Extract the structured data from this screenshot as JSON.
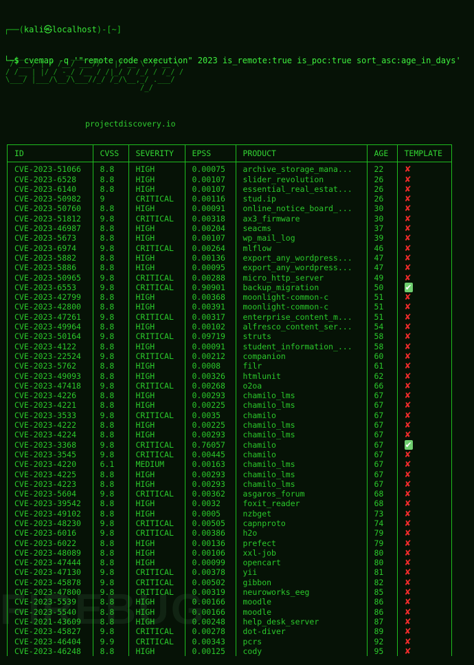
{
  "terminal": {
    "prompt": {
      "line1_prefix": "┌──(",
      "user": "kali",
      "dragon_glyph": "㉿",
      "host": "localhost",
      "line1_suffix": ")-[~]",
      "line2_prefix": "└─$ ",
      "command": "cvemap -q '\"remote code execution\" 2023 is_remote:true is_poc:true sort_asc:age_in_days'"
    },
    "banner_ascii": " ______   _    _____ ___  ____    ____ \n / ___/ | / /__/ ___//   |/ __ \\  / __ \\\n/ /__ | |/ / -_/ /__ / /|_/ / /_/ / /_/ /\n\\___/ |___/\\__/\\___//_/ /_/\\__,_/ .___/ \n                               /_/      ",
    "tagline": "projectdiscovery.io",
    "watermark": "FIREBUG"
  },
  "table": {
    "columns": [
      {
        "key": "id",
        "label": "ID"
      },
      {
        "key": "cvss",
        "label": "CVSS"
      },
      {
        "key": "severity",
        "label": "SEVERITY"
      },
      {
        "key": "epss",
        "label": "EPSS"
      },
      {
        "key": "product",
        "label": "PRODUCT"
      },
      {
        "key": "age",
        "label": "AGE"
      },
      {
        "key": "template",
        "label": "TEMPLATE"
      }
    ],
    "marks": {
      "no": "✘",
      "yes": "✔",
      "no_icon_name": "cross-mark-icon",
      "yes_icon_name": "check-mark-icon",
      "no_color": "#ee2b2b",
      "yes_bg_color": "#6fcf6f"
    },
    "rows": [
      {
        "id": "CVE-2023-51066",
        "cvss": "8.8",
        "severity": "HIGH",
        "epss": "0.00075",
        "product": "archive_storage_mana...",
        "age": "22",
        "template": "no"
      },
      {
        "id": "CVE-2023-6528",
        "cvss": "8.8",
        "severity": "HIGH",
        "epss": "0.00107",
        "product": "slider_revolution",
        "age": "26",
        "template": "no"
      },
      {
        "id": "CVE-2023-6140",
        "cvss": "8.8",
        "severity": "HIGH",
        "epss": "0.00107",
        "product": "essential_real_estat...",
        "age": "26",
        "template": "no"
      },
      {
        "id": "CVE-2023-50982",
        "cvss": "9",
        "severity": "CRITICAL",
        "epss": "0.00116",
        "product": "stud.ip",
        "age": "26",
        "template": "no"
      },
      {
        "id": "CVE-2023-50760",
        "cvss": "8.8",
        "severity": "HIGH",
        "epss": "0.00091",
        "product": "online_notice_board_...",
        "age": "30",
        "template": "no"
      },
      {
        "id": "CVE-2023-51812",
        "cvss": "9.8",
        "severity": "CRITICAL",
        "epss": "0.00318",
        "product": "ax3_firmware",
        "age": "30",
        "template": "no"
      },
      {
        "id": "CVE-2023-46987",
        "cvss": "8.8",
        "severity": "HIGH",
        "epss": "0.00204",
        "product": "seacms",
        "age": "37",
        "template": "no"
      },
      {
        "id": "CVE-2023-5673",
        "cvss": "8.8",
        "severity": "HIGH",
        "epss": "0.00107",
        "product": "wp_mail_log",
        "age": "39",
        "template": "no"
      },
      {
        "id": "CVE-2023-6974",
        "cvss": "9.8",
        "severity": "CRITICAL",
        "epss": "0.00264",
        "product": "mlflow",
        "age": "46",
        "template": "no"
      },
      {
        "id": "CVE-2023-5882",
        "cvss": "8.8",
        "severity": "HIGH",
        "epss": "0.00136",
        "product": "export_any_wordpress...",
        "age": "47",
        "template": "no"
      },
      {
        "id": "CVE-2023-5886",
        "cvss": "8.8",
        "severity": "HIGH",
        "epss": "0.00095",
        "product": "export_any_wordpress...",
        "age": "47",
        "template": "no"
      },
      {
        "id": "CVE-2023-50965",
        "cvss": "9.8",
        "severity": "CRITICAL",
        "epss": "0.00288",
        "product": "micro_http_server",
        "age": "49",
        "template": "no"
      },
      {
        "id": "CVE-2023-6553",
        "cvss": "9.8",
        "severity": "CRITICAL",
        "epss": "0.90901",
        "product": "backup_migration",
        "age": "50",
        "template": "yes"
      },
      {
        "id": "CVE-2023-42799",
        "cvss": "8.8",
        "severity": "HIGH",
        "epss": "0.00368",
        "product": "moonlight-common-c",
        "age": "51",
        "template": "no"
      },
      {
        "id": "CVE-2023-42800",
        "cvss": "8.8",
        "severity": "HIGH",
        "epss": "0.00391",
        "product": "moonlight-common-c",
        "age": "51",
        "template": "no"
      },
      {
        "id": "CVE-2023-47261",
        "cvss": "9.8",
        "severity": "CRITICAL",
        "epss": "0.00317",
        "product": "enterprise_content_m...",
        "age": "51",
        "template": "no"
      },
      {
        "id": "CVE-2023-49964",
        "cvss": "8.8",
        "severity": "HIGH",
        "epss": "0.00102",
        "product": "alfresco_content_ser...",
        "age": "54",
        "template": "no"
      },
      {
        "id": "CVE-2023-50164",
        "cvss": "9.8",
        "severity": "CRITICAL",
        "epss": "0.09719",
        "product": "struts",
        "age": "58",
        "template": "no"
      },
      {
        "id": "CVE-2023-4122",
        "cvss": "8.8",
        "severity": "HIGH",
        "epss": "0.00091",
        "product": "student_information_...",
        "age": "58",
        "template": "no"
      },
      {
        "id": "CVE-2023-22524",
        "cvss": "9.8",
        "severity": "CRITICAL",
        "epss": "0.00212",
        "product": "companion",
        "age": "60",
        "template": "no"
      },
      {
        "id": "CVE-2023-5762",
        "cvss": "8.8",
        "severity": "HIGH",
        "epss": "0.0008",
        "product": "filr",
        "age": "61",
        "template": "no"
      },
      {
        "id": "CVE-2023-49093",
        "cvss": "8.8",
        "severity": "HIGH",
        "epss": "0.00326",
        "product": "htmlunit",
        "age": "62",
        "template": "no"
      },
      {
        "id": "CVE-2023-47418",
        "cvss": "9.8",
        "severity": "CRITICAL",
        "epss": "0.00268",
        "product": "o2oa",
        "age": "66",
        "template": "no"
      },
      {
        "id": "CVE-2023-4226",
        "cvss": "8.8",
        "severity": "HIGH",
        "epss": "0.00293",
        "product": "chamilo_lms",
        "age": "67",
        "template": "no"
      },
      {
        "id": "CVE-2023-4221",
        "cvss": "8.8",
        "severity": "HIGH",
        "epss": "0.00225",
        "product": "chamilo_lms",
        "age": "67",
        "template": "no"
      },
      {
        "id": "CVE-2023-3533",
        "cvss": "9.8",
        "severity": "CRITICAL",
        "epss": "0.0035",
        "product": "chamilo",
        "age": "67",
        "template": "no"
      },
      {
        "id": "CVE-2023-4222",
        "cvss": "8.8",
        "severity": "HIGH",
        "epss": "0.00225",
        "product": "chamilo_lms",
        "age": "67",
        "template": "no"
      },
      {
        "id": "CVE-2023-4224",
        "cvss": "8.8",
        "severity": "HIGH",
        "epss": "0.00293",
        "product": "chamilo_lms",
        "age": "67",
        "template": "no"
      },
      {
        "id": "CVE-2023-3368",
        "cvss": "9.8",
        "severity": "CRITICAL",
        "epss": "0.76057",
        "product": "chamilo",
        "age": "67",
        "template": "yes"
      },
      {
        "id": "CVE-2023-3545",
        "cvss": "9.8",
        "severity": "CRITICAL",
        "epss": "0.00445",
        "product": "chamilo",
        "age": "67",
        "template": "no"
      },
      {
        "id": "CVE-2023-4220",
        "cvss": "6.1",
        "severity": "MEDIUM",
        "epss": "0.00163",
        "product": "chamilo_lms",
        "age": "67",
        "template": "no"
      },
      {
        "id": "CVE-2023-4225",
        "cvss": "8.8",
        "severity": "HIGH",
        "epss": "0.00293",
        "product": "chamilo_lms",
        "age": "67",
        "template": "no"
      },
      {
        "id": "CVE-2023-4223",
        "cvss": "8.8",
        "severity": "HIGH",
        "epss": "0.00293",
        "product": "chamilo_lms",
        "age": "67",
        "template": "no"
      },
      {
        "id": "CVE-2023-5604",
        "cvss": "9.8",
        "severity": "CRITICAL",
        "epss": "0.00362",
        "product": "asgaros_forum",
        "age": "68",
        "template": "no"
      },
      {
        "id": "CVE-2023-39542",
        "cvss": "8.8",
        "severity": "HIGH",
        "epss": "0.0032",
        "product": "foxit_reader",
        "age": "68",
        "template": "no"
      },
      {
        "id": "CVE-2023-49102",
        "cvss": "8.8",
        "severity": "HIGH",
        "epss": "0.0005",
        "product": "nzbget",
        "age": "73",
        "template": "no"
      },
      {
        "id": "CVE-2023-48230",
        "cvss": "9.8",
        "severity": "CRITICAL",
        "epss": "0.00505",
        "product": "capnproto",
        "age": "74",
        "template": "no"
      },
      {
        "id": "CVE-2023-6016",
        "cvss": "9.8",
        "severity": "CRITICAL",
        "epss": "0.00386",
        "product": "h2o",
        "age": "79",
        "template": "no"
      },
      {
        "id": "CVE-2023-6022",
        "cvss": "8.8",
        "severity": "HIGH",
        "epss": "0.00136",
        "product": "prefect",
        "age": "79",
        "template": "no"
      },
      {
        "id": "CVE-2023-48089",
        "cvss": "8.8",
        "severity": "HIGH",
        "epss": "0.00106",
        "product": "xxl-job",
        "age": "80",
        "template": "no"
      },
      {
        "id": "CVE-2023-47444",
        "cvss": "8.8",
        "severity": "HIGH",
        "epss": "0.00099",
        "product": "opencart",
        "age": "80",
        "template": "no"
      },
      {
        "id": "CVE-2023-47130",
        "cvss": "9.8",
        "severity": "CRITICAL",
        "epss": "0.00378",
        "product": "yii",
        "age": "81",
        "template": "no"
      },
      {
        "id": "CVE-2023-45878",
        "cvss": "9.8",
        "severity": "CRITICAL",
        "epss": "0.00502",
        "product": "gibbon",
        "age": "82",
        "template": "no"
      },
      {
        "id": "CVE-2023-47800",
        "cvss": "9.8",
        "severity": "CRITICAL",
        "epss": "0.00319",
        "product": "neuroworks_eeg",
        "age": "85",
        "template": "no"
      },
      {
        "id": "CVE-2023-5539",
        "cvss": "8.8",
        "severity": "HIGH",
        "epss": "0.00166",
        "product": "moodle",
        "age": "86",
        "template": "no"
      },
      {
        "id": "CVE-2023-5540",
        "cvss": "8.8",
        "severity": "HIGH",
        "epss": "0.00166",
        "product": "moodle",
        "age": "86",
        "template": "no"
      },
      {
        "id": "CVE-2021-43609",
        "cvss": "8.8",
        "severity": "HIGH",
        "epss": "0.00248",
        "product": "help_desk_server",
        "age": "87",
        "template": "no"
      },
      {
        "id": "CVE-2023-45827",
        "cvss": "9.8",
        "severity": "CRITICAL",
        "epss": "0.00278",
        "product": "dot-diver",
        "age": "89",
        "template": "no"
      },
      {
        "id": "CVE-2023-46404",
        "cvss": "9.9",
        "severity": "CRITICAL",
        "epss": "0.00343",
        "product": "pcrs",
        "age": "92",
        "template": "no"
      },
      {
        "id": "CVE-2023-46248",
        "cvss": "8.8",
        "severity": "HIGH",
        "epss": "0.00125",
        "product": "cody",
        "age": "95",
        "template": "no"
      }
    ]
  }
}
